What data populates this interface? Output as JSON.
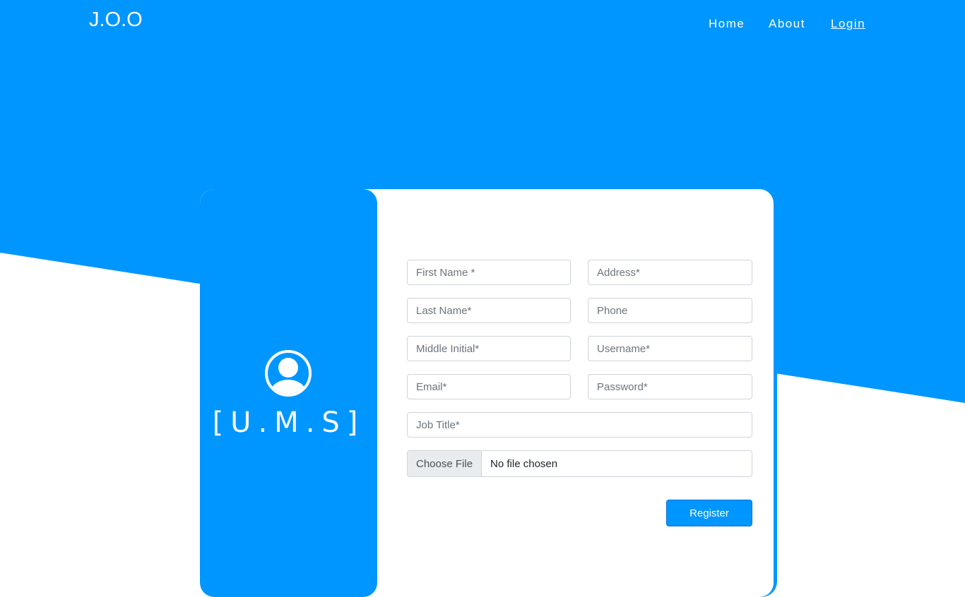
{
  "navbar": {
    "brand": "J.O.O",
    "links": [
      {
        "label": "Home"
      },
      {
        "label": "About"
      },
      {
        "label": "Login"
      }
    ]
  },
  "card": {
    "logo_text": "[U.M.S]",
    "icon": "user-circle-icon"
  },
  "form": {
    "first_name": {
      "placeholder": "First Name *",
      "value": ""
    },
    "address": {
      "placeholder": "Address*",
      "value": ""
    },
    "last_name": {
      "placeholder": "Last Name*",
      "value": ""
    },
    "phone": {
      "placeholder": "Phone",
      "value": ""
    },
    "middle_initial": {
      "placeholder": "Middle Initial*",
      "value": ""
    },
    "username": {
      "placeholder": "Username*",
      "value": ""
    },
    "email": {
      "placeholder": "Email*",
      "value": ""
    },
    "password": {
      "placeholder": "Password*",
      "value": ""
    },
    "job_title": {
      "placeholder": "Job Title*",
      "value": ""
    },
    "file": {
      "button_label": "Choose File",
      "status": "No file chosen"
    },
    "register_label": "Register"
  },
  "colors": {
    "primary": "#0096ff",
    "background": "#ffffff"
  }
}
